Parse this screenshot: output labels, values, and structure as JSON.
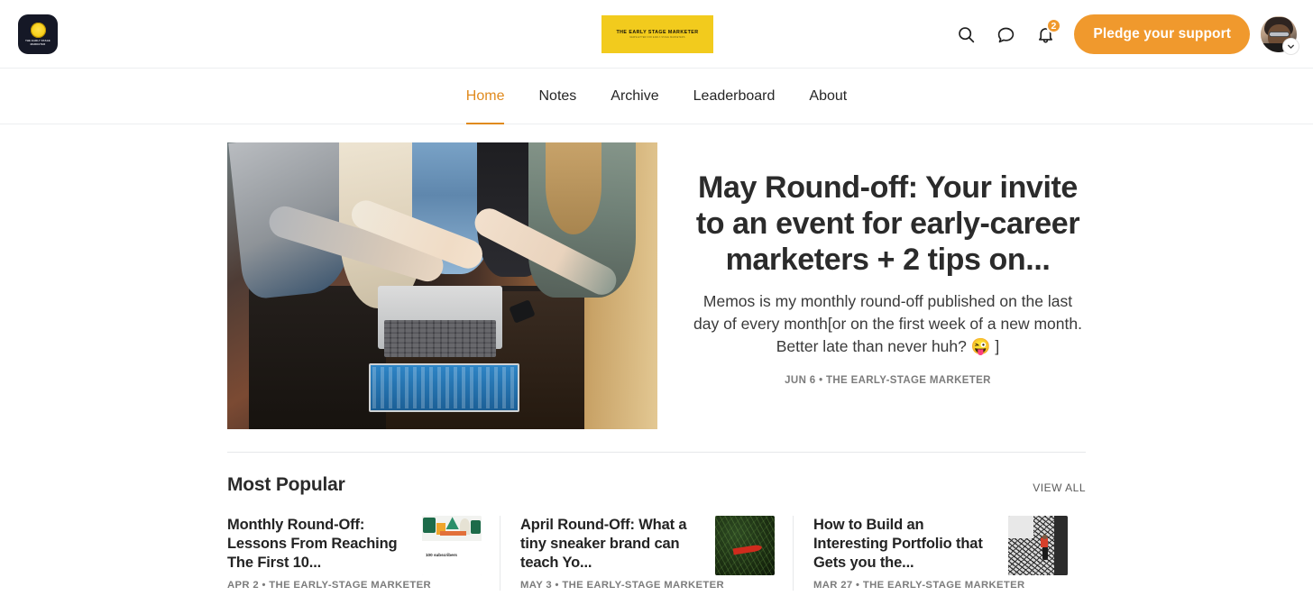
{
  "header": {
    "logo": {
      "name": "the-early-stage-marketer-logo",
      "text": "The Early Stage Marketer"
    },
    "banner": {
      "title": "THE EARLY STAGE MARKETER",
      "subtitle": "Newsletter for early-stage marketers"
    },
    "icons": {
      "search": "search-icon",
      "chat": "chat-bubble-icon",
      "bell": "bell-icon"
    },
    "notification_count": "2",
    "pledge_label": "Pledge your support",
    "avatar_alt": "User avatar",
    "accent_color": "#F0992D"
  },
  "nav": {
    "items": [
      {
        "label": "Home",
        "active": true
      },
      {
        "label": "Notes",
        "active": false
      },
      {
        "label": "Archive",
        "active": false
      },
      {
        "label": "Leaderboard",
        "active": false
      },
      {
        "label": "About",
        "active": false
      }
    ]
  },
  "hero": {
    "image_alt": "Overhead view of three people pointing at a laptop on a dark wooden table",
    "title": "May Round-off: Your invite to an event for early-career marketers + 2 tips on...",
    "description": "Memos is my monthly round-off published on the last day of every month[or on the first week of a new month. Better late than never huh? 😜 ]",
    "date": "JUN 6",
    "publication": "THE EARLY-STAGE MARKETER",
    "meta": "JUN 6 • THE EARLY-STAGE MARKETER"
  },
  "popular": {
    "title": "Most Popular",
    "view_all_label": "VIEW ALL",
    "cards": [
      {
        "title": "Monthly Round-Off: Lessons From Reaching The First 10...",
        "date": "APR 2",
        "publication": "THE EARLY-STAGE MARKETER",
        "meta": "APR 2 • THE EARLY-STAGE MARKETER",
        "thumb_alt": "Illustrated card artwork",
        "thumb_caption": "100 subscribers"
      },
      {
        "title": "April Round-Off: What a tiny sneaker brand can teach Yo...",
        "date": "MAY 3",
        "publication": "THE EARLY-STAGE MARKETER",
        "meta": "MAY 3 • THE EARLY-STAGE MARKETER",
        "thumb_alt": "Red swoosh logo lying in green grass"
      },
      {
        "title": "How to Build an Interesting Portfolio that Gets you the...",
        "date": "MAR 27",
        "publication": "THE EARLY-STAGE MARKETER",
        "meta": "MAR 27 • THE EARLY-STAGE MARKETER",
        "thumb_alt": "Person in red top standing against a patterned wall"
      }
    ]
  }
}
